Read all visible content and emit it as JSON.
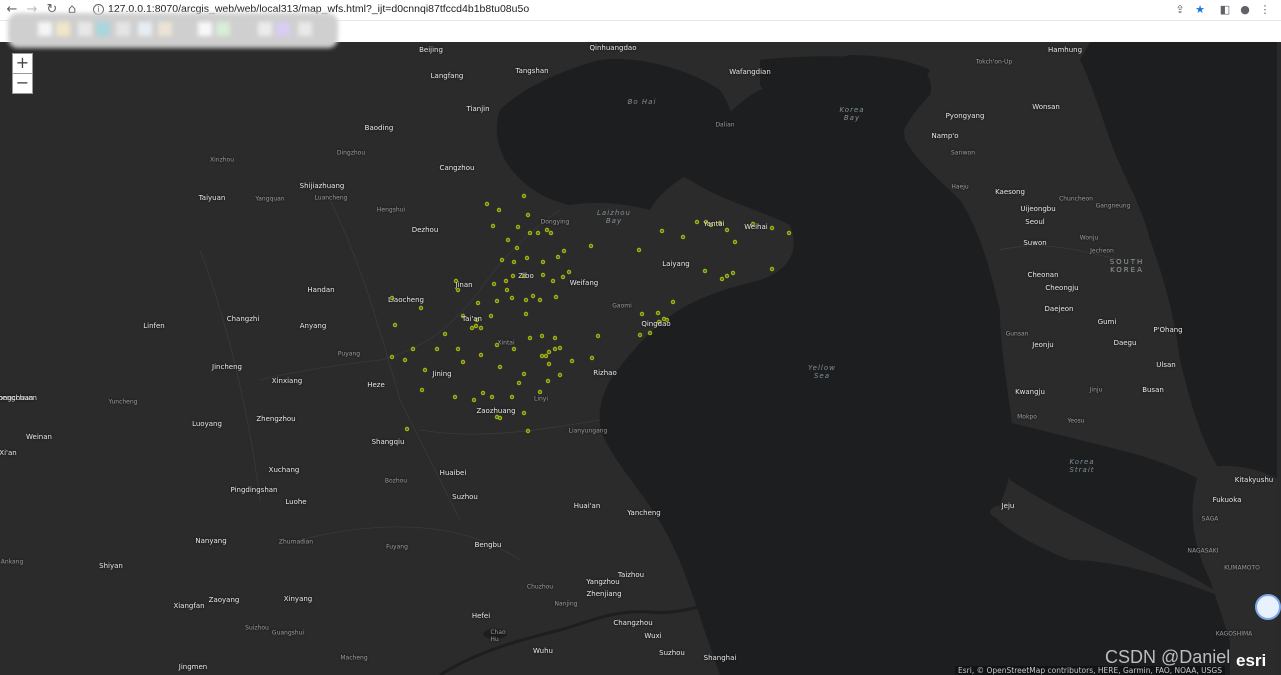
{
  "browser": {
    "url": "127.0.0.1:8070/arcgis_web/web/local313/map_wfs.html?_ijt=d0cnnqi87tfccd4b1b8tu08u5o",
    "back": "←",
    "forward": "→",
    "reload": "↻",
    "home": "⌂",
    "info": "i",
    "share": "⇪",
    "star": "★",
    "sidebar": "◧",
    "account": "●",
    "menu": "⋮",
    "star_color": "#1a73e8"
  },
  "zoom": {
    "in": "+",
    "out": "−"
  },
  "map": {
    "land_color": "#2b2b2b",
    "water_color": "#1d1e20",
    "marker_fill": "#2a8f2a",
    "marker_stroke": "#e6b800",
    "water_labels": [
      {
        "id": "bohai",
        "text": "Bo Hai"
      },
      {
        "id": "laizhou",
        "text": "Laizhou\nBay"
      },
      {
        "id": "koreabay",
        "text": "Korea\nBay"
      },
      {
        "id": "yellowsea",
        "text": "Yellow\nSea"
      },
      {
        "id": "koreastrait",
        "text": "Korea\nStrait"
      }
    ],
    "country_labels": [
      {
        "id": "southkorea",
        "text": "SOUTH\nKOREA"
      }
    ],
    "cities": [
      {
        "name": "Beijing",
        "size": "major"
      },
      {
        "name": "Qinhuangdao",
        "size": "major"
      },
      {
        "name": "Hamhung",
        "size": "major"
      },
      {
        "name": "Langfang",
        "size": "major"
      },
      {
        "name": "Tangshan",
        "size": "major"
      },
      {
        "name": "Wafangdian",
        "size": "major"
      },
      {
        "name": "Tokch'on-Up",
        "size": "small"
      },
      {
        "name": "Tianjin",
        "size": "major"
      },
      {
        "name": "Wonsan",
        "size": "major"
      },
      {
        "name": "Pyongyang",
        "size": "major"
      },
      {
        "name": "Baoding",
        "size": "major"
      },
      {
        "name": "Dalian",
        "size": "small"
      },
      {
        "name": "Namp'o",
        "size": "major"
      },
      {
        "name": "Xinzhou",
        "size": "small"
      },
      {
        "name": "Dingzhou",
        "size": "small"
      },
      {
        "name": "Sariwon",
        "size": "small"
      },
      {
        "name": "Cangzhou",
        "size": "major"
      },
      {
        "name": "Taiyuan",
        "size": "major"
      },
      {
        "name": "Shijiazhuang",
        "size": "major"
      },
      {
        "name": "Yangquan",
        "size": "small"
      },
      {
        "name": "Luancheng",
        "size": "small"
      },
      {
        "name": "Haeju",
        "size": "small"
      },
      {
        "name": "Kaesong",
        "size": "major"
      },
      {
        "name": "Chuncheon",
        "size": "small"
      },
      {
        "name": "Hengshui",
        "size": "small"
      },
      {
        "name": "Dongying",
        "size": "small"
      },
      {
        "name": "Uijeongbu",
        "size": "major"
      },
      {
        "name": "Gangneung",
        "size": "small"
      },
      {
        "name": "Yantai",
        "size": "major"
      },
      {
        "name": "Weihai",
        "size": "major"
      },
      {
        "name": "Seoul",
        "size": "major"
      },
      {
        "name": "Dezhou",
        "size": "major"
      },
      {
        "name": "Wonju",
        "size": "small"
      },
      {
        "name": "Suwon",
        "size": "major"
      },
      {
        "name": "Jecheon",
        "size": "small"
      },
      {
        "name": "Laiyang",
        "size": "major"
      },
      {
        "name": "Cheonan",
        "size": "major"
      },
      {
        "name": "Zibo",
        "size": "major"
      },
      {
        "name": "Jinan",
        "size": "major"
      },
      {
        "name": "Weifang",
        "size": "major"
      },
      {
        "name": "Handan",
        "size": "major"
      },
      {
        "name": "Cheongju",
        "size": "major"
      },
      {
        "name": "Liaocheng",
        "size": "major"
      },
      {
        "name": "Gaomi",
        "size": "small"
      },
      {
        "name": "Daejeon",
        "size": "major"
      },
      {
        "name": "Linfen",
        "size": "major"
      },
      {
        "name": "Changzhi",
        "size": "major"
      },
      {
        "name": "Anyang",
        "size": "major"
      },
      {
        "name": "Tai'an",
        "size": "major"
      },
      {
        "name": "Qingdao",
        "size": "major"
      },
      {
        "name": "Gumi",
        "size": "major"
      },
      {
        "name": "P'Ohang",
        "size": "major"
      },
      {
        "name": "Gunsan",
        "size": "small"
      },
      {
        "name": "Xintai",
        "size": "small"
      },
      {
        "name": "Jeonju",
        "size": "major"
      },
      {
        "name": "Daegu",
        "size": "major"
      },
      {
        "name": "Puyang",
        "size": "small"
      },
      {
        "name": "Ulsan",
        "size": "major"
      },
      {
        "name": "Jincheng",
        "size": "major"
      },
      {
        "name": "Jining",
        "size": "major"
      },
      {
        "name": "Rizhao",
        "size": "major"
      },
      {
        "name": "Xinxiang",
        "size": "major"
      },
      {
        "name": "Heze",
        "size": "major"
      },
      {
        "name": "Kwangju",
        "size": "major"
      },
      {
        "name": "Jinju",
        "size": "small"
      },
      {
        "name": "Busan",
        "size": "major"
      },
      {
        "name": "Zhengchuan",
        "size": "major"
      },
      {
        "name": "Yuncheng",
        "size": "small"
      },
      {
        "name": "Linyi",
        "size": "small"
      },
      {
        "name": "Mokpo",
        "size": "small"
      },
      {
        "name": "Luoyang",
        "size": "major"
      },
      {
        "name": "Zhengzhou",
        "size": "major"
      },
      {
        "name": "Zaozhuang",
        "size": "major"
      },
      {
        "name": "Yeosu",
        "size": "small"
      },
      {
        "name": "Lianyungang",
        "size": "small"
      },
      {
        "name": "Weinan",
        "size": "major"
      },
      {
        "name": "Shangqiu",
        "size": "major"
      },
      {
        "name": "Xi'an",
        "size": "major"
      },
      {
        "name": "Xuchang",
        "size": "major"
      },
      {
        "name": "Huaibei",
        "size": "major"
      },
      {
        "name": "Kitakyushu",
        "size": "major"
      },
      {
        "name": "Bozhou",
        "size": "small"
      },
      {
        "name": "Pingdingshan",
        "size": "major"
      },
      {
        "name": "Suzhou",
        "size": "major"
      },
      {
        "name": "Fukuoka",
        "size": "major"
      },
      {
        "name": "Luohe",
        "size": "major"
      },
      {
        "name": "Huai'an",
        "size": "major"
      },
      {
        "name": "Jeju",
        "size": "major"
      },
      {
        "name": "Yancheng",
        "size": "major"
      },
      {
        "name": "SAGA",
        "size": "small"
      },
      {
        "name": "Nanyang",
        "size": "major"
      },
      {
        "name": "Zhumadian",
        "size": "small"
      },
      {
        "name": "Bengbu",
        "size": "major"
      },
      {
        "name": "Fuyang",
        "size": "small"
      },
      {
        "name": "NAGASAKI",
        "size": "small"
      },
      {
        "name": "Ankang",
        "size": "small"
      },
      {
        "name": "Shiyan",
        "size": "major"
      },
      {
        "name": "KUMAMOTO",
        "size": "small"
      },
      {
        "name": "Taizhou",
        "size": "major"
      },
      {
        "name": "Chuzhou",
        "size": "small"
      },
      {
        "name": "Yangzhou",
        "size": "major"
      },
      {
        "name": "Zhenjiang",
        "size": "major"
      },
      {
        "name": "Zaoyang",
        "size": "major"
      },
      {
        "name": "Xinyang",
        "size": "major"
      },
      {
        "name": "Nanjing",
        "size": "small"
      },
      {
        "name": "Xiangfan",
        "size": "major"
      },
      {
        "name": "Suizhou",
        "size": "small"
      },
      {
        "name": "Guangshui",
        "size": "small"
      },
      {
        "name": "Hefei",
        "size": "major"
      },
      {
        "name": "Changzhou",
        "size": "major"
      },
      {
        "name": "Wuxi",
        "size": "major"
      },
      {
        "name": "Chao\nHu",
        "size": "small"
      },
      {
        "name": "KAGOSHIMA",
        "size": "small"
      },
      {
        "name": "Wuhu",
        "size": "major"
      },
      {
        "name": "Suzhou",
        "size": "major"
      },
      {
        "name": "Shanghai",
        "size": "major"
      },
      {
        "name": "Jingmen",
        "size": "major"
      },
      {
        "name": "Macheng",
        "size": "small"
      },
      {
        "name": "ongchuan",
        "size": "major"
      }
    ]
  },
  "attribution": "Esri, © OpenStreetMap contributors, HERE, Garmin, FAO, NOAA, USGS",
  "watermark": "CSDN @Daniel",
  "esri_logo": "esri"
}
